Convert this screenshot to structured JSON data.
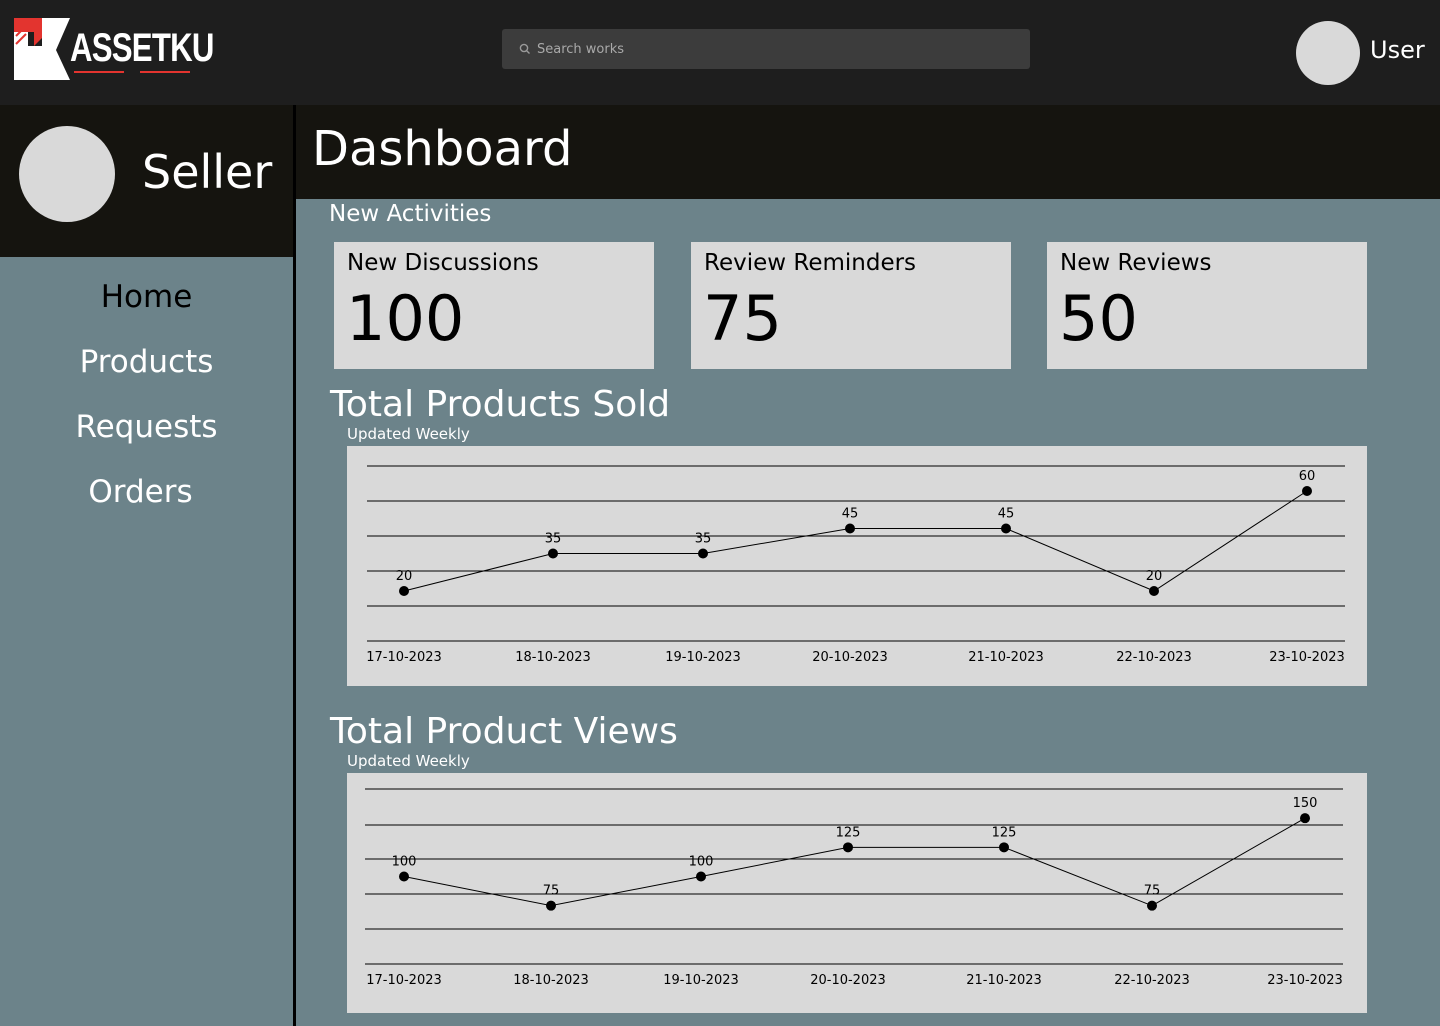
{
  "header": {
    "logo_text": "ASSETKU",
    "search_placeholder": "Search works",
    "user_label": "User"
  },
  "sidebar": {
    "role_label": "Seller",
    "items": [
      {
        "label": "Home"
      },
      {
        "label": "Products"
      },
      {
        "label": "Requests"
      },
      {
        "label": "Orders"
      }
    ]
  },
  "main": {
    "title": "Dashboard",
    "activities_label": "New Activities",
    "cards": [
      {
        "title": "New Discussions",
        "value": "100"
      },
      {
        "title": "Review Reminders",
        "value": "75"
      },
      {
        "title": "New Reviews",
        "value": "50"
      }
    ]
  },
  "colors": {
    "topbar": "#1e1e1e",
    "header_dark": "#15140f",
    "panel": "#6c838a",
    "card": "#d9d9d9",
    "active_nav": "#000000",
    "nav_text": "#ffffff"
  },
  "chart_data": [
    {
      "type": "line",
      "title": "Total Products Sold",
      "subtitle": "Updated Weekly",
      "categories": [
        "17-10-2023",
        "18-10-2023",
        "19-10-2023",
        "20-10-2023",
        "21-10-2023",
        "22-10-2023",
        "23-10-2023"
      ],
      "values": [
        20,
        35,
        35,
        45,
        45,
        20,
        60
      ],
      "ylim": [
        0,
        70
      ],
      "grid": true
    },
    {
      "type": "line",
      "title": "Total Product Views",
      "subtitle": "Updated Weekly",
      "categories": [
        "17-10-2023",
        "18-10-2023",
        "19-10-2023",
        "20-10-2023",
        "21-10-2023",
        "22-10-2023",
        "23-10-2023"
      ],
      "values": [
        100,
        75,
        100,
        125,
        125,
        75,
        150
      ],
      "ylim": [
        25,
        175
      ],
      "grid": true
    }
  ]
}
